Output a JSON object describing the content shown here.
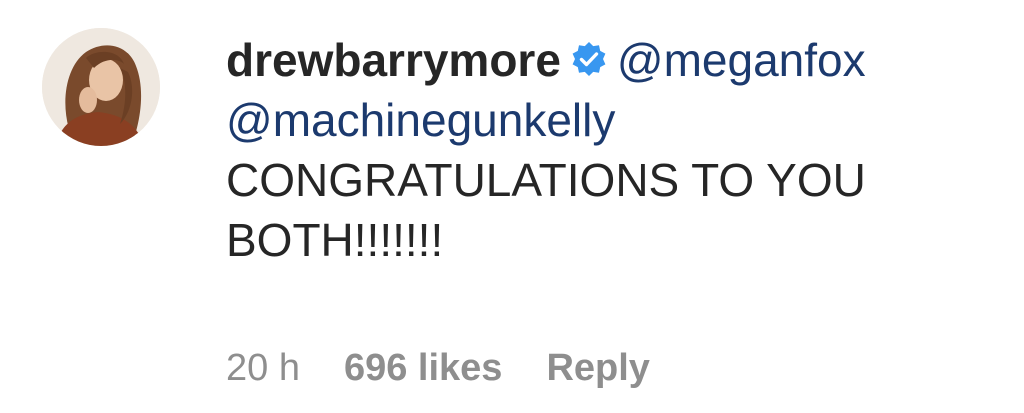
{
  "comment": {
    "username": "drewbarrymore",
    "verified_icon": "verified-badge-icon",
    "mentions": [
      "@meganfox",
      "@machinegunkelly"
    ],
    "text_line1": "CONGRATULATIONS TO YOU",
    "text_line2": "BOTH!!!!!!!",
    "time": "20 h",
    "likes": "696 likes",
    "reply": "Reply"
  },
  "colors": {
    "username": "#262626",
    "mention": "#1c3a6e",
    "text": "#262626",
    "meta": "#8e8e8e",
    "verified": "#3897f0"
  }
}
